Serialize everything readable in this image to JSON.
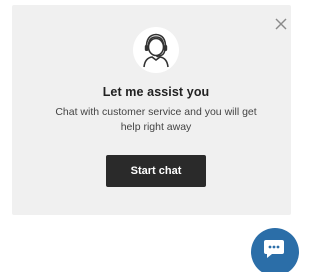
{
  "widget": {
    "title": "Let me assist you",
    "subtitle": "Chat with customer service and you will get help right away",
    "start_button_label": "Start chat",
    "close_icon": "close-icon",
    "avatar_icon": "customer-service-agent-icon"
  },
  "launcher": {
    "icon": "chat-bubble-icon"
  },
  "colors": {
    "card_background": "#f0f0f0",
    "button_background": "#2a2a2a",
    "button_text": "#ffffff",
    "launcher_background": "#2b6ea8"
  }
}
